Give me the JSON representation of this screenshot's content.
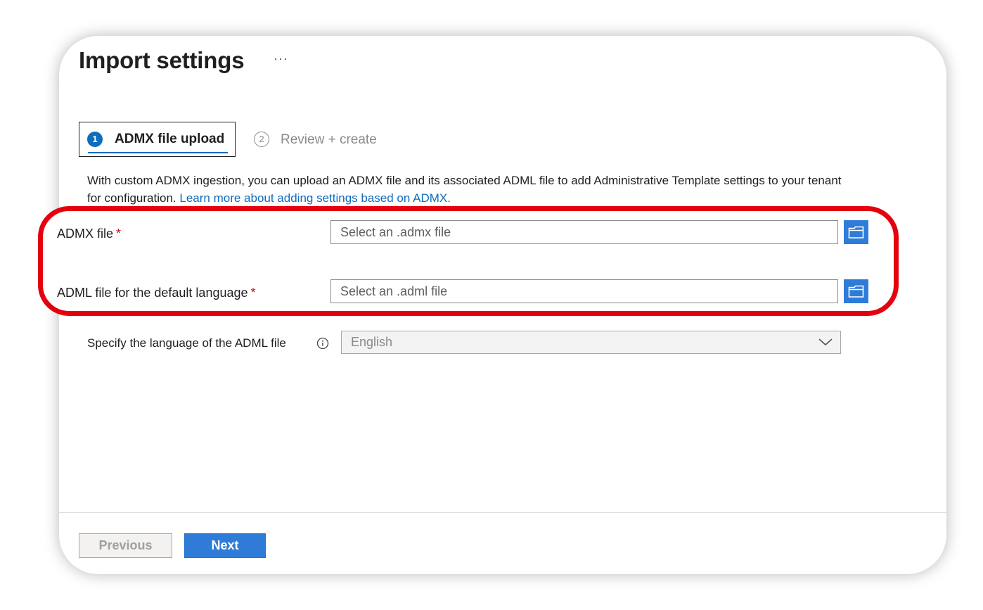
{
  "header": {
    "title": "Import settings",
    "more_label": "···"
  },
  "steps": [
    {
      "number": "1",
      "label": "ADMX file upload",
      "active": true
    },
    {
      "number": "2",
      "label": "Review + create",
      "active": false
    }
  ],
  "description": {
    "text": "With custom ADMX ingestion, you can upload an ADMX file and its associated ADML file to add Administrative Template settings to your tenant for configuration.",
    "link_text": "Learn more about adding settings based on ADMX."
  },
  "form": {
    "admx": {
      "label": "ADMX file",
      "required_mark": "*",
      "placeholder": "Select an .admx file"
    },
    "adml": {
      "label": "ADML file for the default language",
      "required_mark": "*",
      "placeholder": "Select an .adml file"
    },
    "language": {
      "label": "Specify the language of the ADML file",
      "value": "English"
    }
  },
  "footer": {
    "previous_label": "Previous",
    "next_label": "Next"
  },
  "colors": {
    "accent": "#2f7bd8",
    "link": "#0f6cbd",
    "required": "#c50f1f",
    "highlight": "#e3000f"
  },
  "icons": {
    "more": "more-horizontal-icon",
    "browse": "folder-icon",
    "info": "info-icon",
    "dropdown": "chevron-down-icon"
  }
}
